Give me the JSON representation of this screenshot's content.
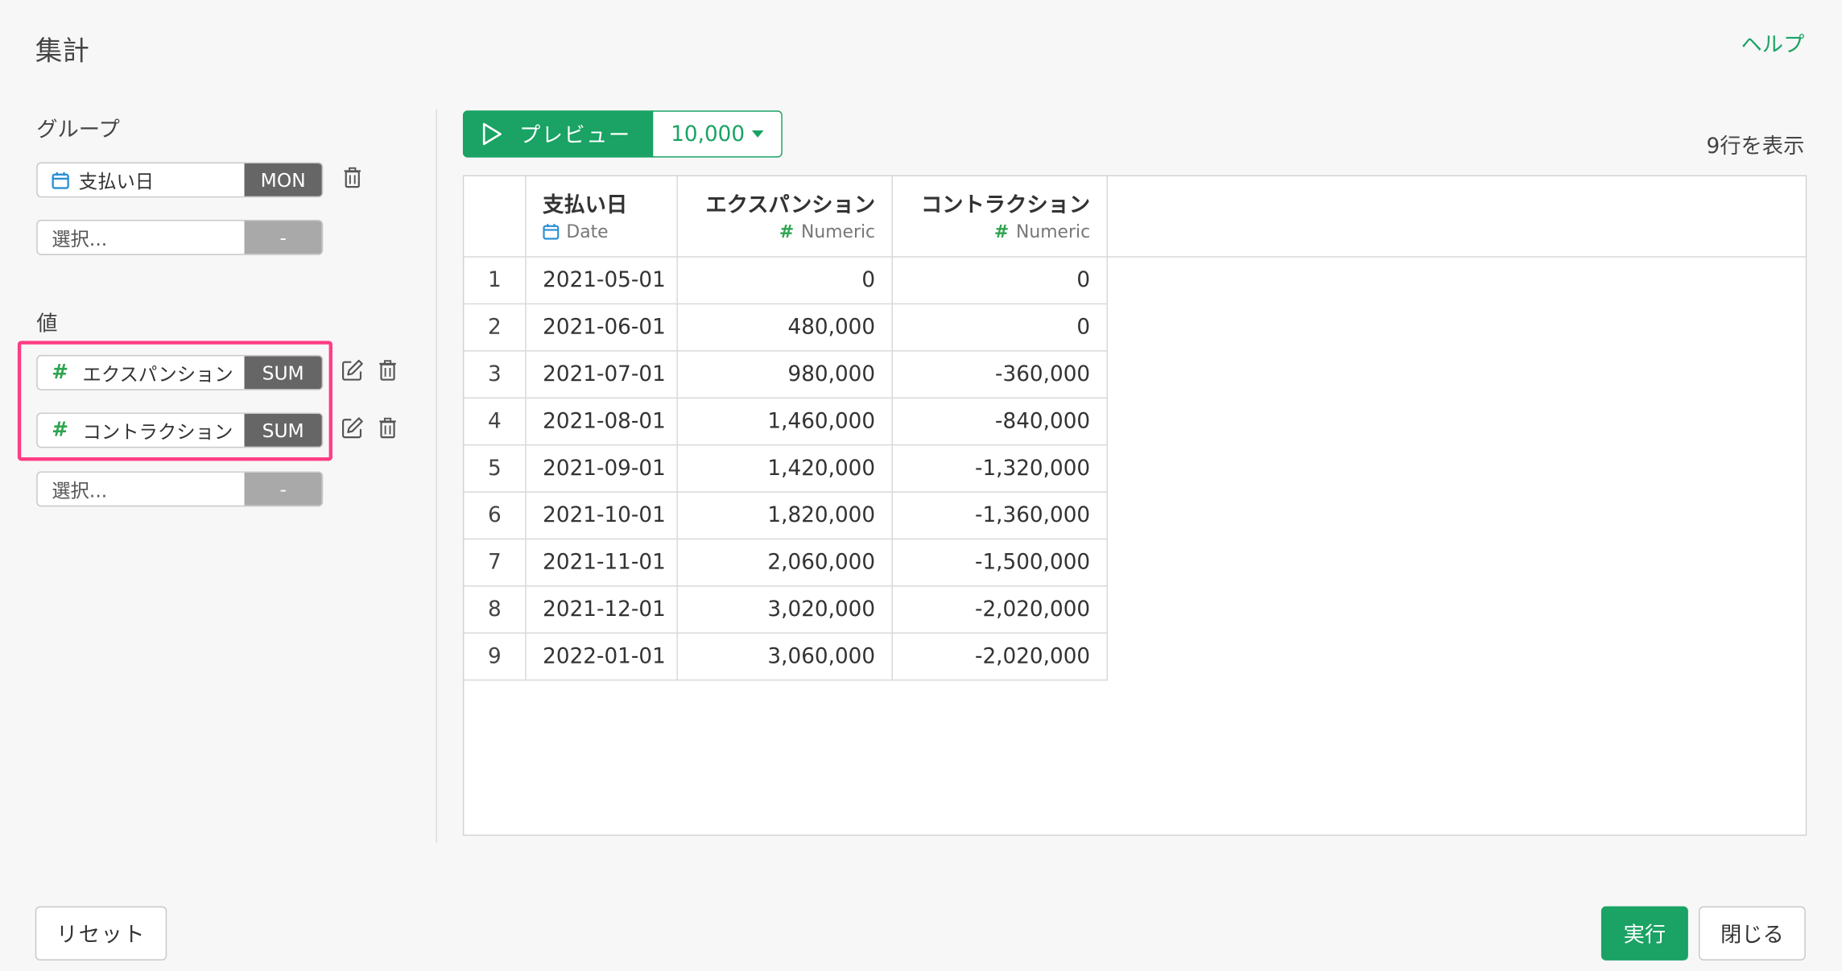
{
  "dialog": {
    "title": "集計",
    "help_label": "ヘルプ"
  },
  "group_section": {
    "label": "グループ",
    "fields": [
      {
        "name": "支払い日",
        "icon": "calendar-icon",
        "agg": "MON"
      }
    ],
    "select_placeholder": "選択...",
    "select_agg": "-"
  },
  "value_section": {
    "label": "値",
    "fields": [
      {
        "name": "エクスパンション",
        "icon": "#",
        "agg": "SUM"
      },
      {
        "name": "コントラクション",
        "icon": "#",
        "agg": "SUM"
      }
    ],
    "select_placeholder": "選択...",
    "select_agg": "-"
  },
  "preview": {
    "button_label": "プレビュー",
    "rows_value": "10,000",
    "row_count_text": "9行を表示"
  },
  "table": {
    "columns": [
      {
        "name": "支払い日",
        "type": "Date"
      },
      {
        "name": "エクスパンション",
        "type": "Numeric"
      },
      {
        "name": "コントラクション",
        "type": "Numeric"
      }
    ],
    "rows": [
      {
        "n": "1",
        "date": "2021-05-01",
        "exp": "0",
        "con": "0"
      },
      {
        "n": "2",
        "date": "2021-06-01",
        "exp": "480,000",
        "con": "0"
      },
      {
        "n": "3",
        "date": "2021-07-01",
        "exp": "980,000",
        "con": "-360,000"
      },
      {
        "n": "4",
        "date": "2021-08-01",
        "exp": "1,460,000",
        "con": "-840,000"
      },
      {
        "n": "5",
        "date": "2021-09-01",
        "exp": "1,420,000",
        "con": "-1,320,000"
      },
      {
        "n": "6",
        "date": "2021-10-01",
        "exp": "1,820,000",
        "con": "-1,360,000"
      },
      {
        "n": "7",
        "date": "2021-11-01",
        "exp": "2,060,000",
        "con": "-1,500,000"
      },
      {
        "n": "8",
        "date": "2021-12-01",
        "exp": "3,020,000",
        "con": "-2,020,000"
      },
      {
        "n": "9",
        "date": "2022-01-01",
        "exp": "3,060,000",
        "con": "-2,020,000"
      }
    ]
  },
  "footer": {
    "reset_label": "リセット",
    "run_label": "実行",
    "close_label": "閉じる"
  },
  "colors": {
    "accent": "#1aa364",
    "highlight": "#ff3d84",
    "agg_dark": "#666666",
    "agg_empty": "#a9a9a9"
  }
}
